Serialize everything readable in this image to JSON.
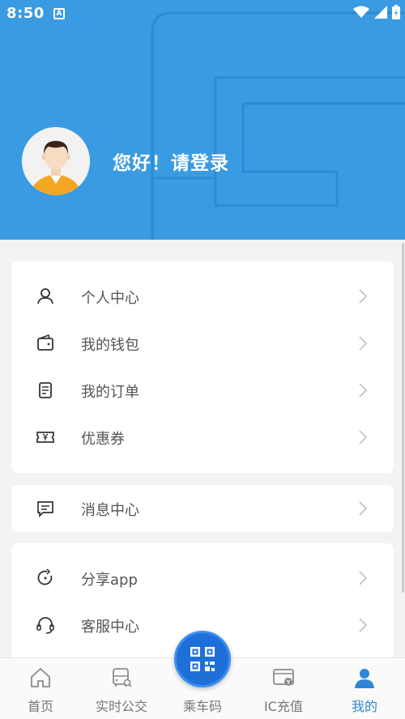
{
  "status_bar": {
    "time": "8:50",
    "notification_badge": "A"
  },
  "profile": {
    "greeting": "您好！请登录"
  },
  "menu_group_1": [
    {
      "label": "个人中心",
      "icon": "user-icon"
    },
    {
      "label": "我的钱包",
      "icon": "wallet-icon"
    },
    {
      "label": "我的订单",
      "icon": "order-icon"
    },
    {
      "label": "优惠券",
      "icon": "coupon-icon"
    }
  ],
  "menu_group_2": [
    {
      "label": "消息中心",
      "icon": "message-icon"
    }
  ],
  "menu_group_3": [
    {
      "label": "分享app",
      "icon": "share-icon"
    },
    {
      "label": "客服中心",
      "icon": "headset-icon"
    }
  ],
  "bottom_nav": [
    {
      "label": "首页",
      "icon": "home-icon",
      "active": false
    },
    {
      "label": "实时公交",
      "icon": "bus-icon",
      "active": false
    },
    {
      "label": "乘车码",
      "icon": "qr-code-icon",
      "active": false
    },
    {
      "label": "IC充值",
      "icon": "card-recharge-icon",
      "active": false
    },
    {
      "label": "我的",
      "icon": "person-icon",
      "active": true
    }
  ],
  "colors": {
    "header": "#3a9be2",
    "accent": "#2f86d6",
    "qr_button": "#1f6fd8"
  }
}
